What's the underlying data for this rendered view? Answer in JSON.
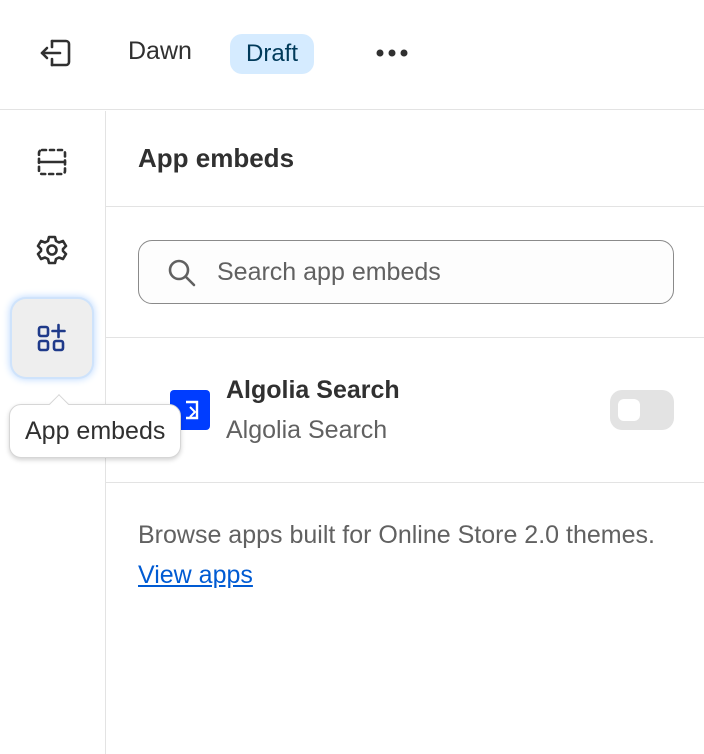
{
  "topbar": {
    "theme_name": "Dawn",
    "status_badge": "Draft",
    "exit_icon": "exit-icon",
    "more_icon": "more-horizontal-icon"
  },
  "rail": {
    "items": [
      {
        "icon": "sections-icon",
        "active": false
      },
      {
        "icon": "gear-icon",
        "active": false
      },
      {
        "icon": "app-embeds-icon",
        "active": true
      }
    ],
    "tooltip": "App embeds"
  },
  "panel": {
    "title": "App embeds",
    "search": {
      "placeholder": "Search app embeds",
      "value": ""
    },
    "embeds": [
      {
        "name": "Algolia Search",
        "source": "Algolia Search",
        "enabled": false,
        "logo_color": "#003dff"
      }
    ],
    "browse_text": "Browse apps built for Online Store 2.0 themes.",
    "browse_link": "View apps"
  },
  "colors": {
    "badge_bg": "#d5ebff",
    "link": "#005bd3",
    "toggle_off": "#e3e3e3"
  }
}
